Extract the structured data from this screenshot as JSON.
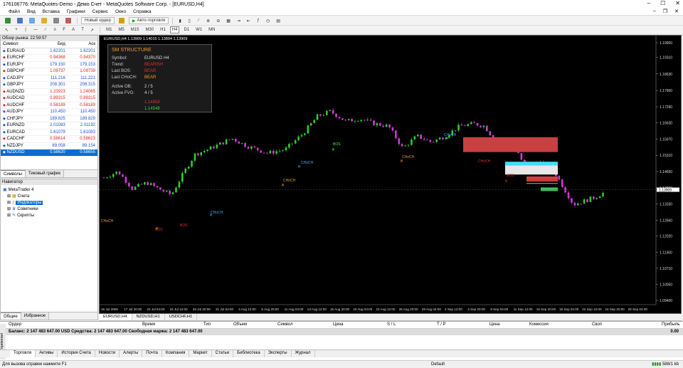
{
  "window": {
    "title": "176106776: MetaQuotes-Demo - Демо Счет - MetaQuotes Software Corp. - [EURUSD,H4]"
  },
  "menu": [
    "Файл",
    "Вид",
    "Вставка",
    "Графики",
    "Сервис",
    "Окно",
    "Справка"
  ],
  "toolbar": {
    "new_order": "Новый ордер",
    "autotrading": "Авто-торговля",
    "timeframes": [
      "M1",
      "M5",
      "M15",
      "M30",
      "H1",
      "H4",
      "D1",
      "W1",
      "MN"
    ]
  },
  "market_watch": {
    "header": "Обзор рынка: 22:59:57",
    "columns": [
      "Символ",
      "Бид",
      "Аск"
    ],
    "rows": [
      {
        "symbol": "EURAUD",
        "bid": "1.62201",
        "ask": "1.62201",
        "color": "#1a4fd6"
      },
      {
        "symbol": "EURCHF",
        "bid": "0.94368",
        "ask": "0.94370",
        "color": "#e02020"
      },
      {
        "symbol": "EURJPY",
        "bid": "179.150",
        "ask": "179.153",
        "color": "#1a4fd6"
      },
      {
        "symbol": "GBPCHF",
        "bid": "1.09737",
        "ask": "1.09739",
        "color": "#e02020"
      },
      {
        "symbol": "CADJPY",
        "bid": "111.216",
        "ask": "111.221",
        "color": "#1a4fd6"
      },
      {
        "symbol": "GBPJPY",
        "bid": "208.301",
        "ask": "208.315",
        "color": "#1a4fd6"
      },
      {
        "symbol": "AUDNZD",
        "bid": "1.23923",
        "ask": "1.24065",
        "color": "#e02020"
      },
      {
        "symbol": "AUDCAD",
        "bid": "0.89315",
        "ask": "0.89315",
        "color": "#e02020"
      },
      {
        "symbol": "AUDCHF",
        "bid": "0.58189",
        "ask": "0.58189",
        "color": "#e02020"
      },
      {
        "symbol": "AUDJPY",
        "bid": "110.450",
        "ask": "110.450",
        "color": "#1a4fd6"
      },
      {
        "symbol": "CHFJPY",
        "bid": "189.825",
        "ask": "189.829",
        "color": "#1a4fd6"
      },
      {
        "symbol": "EURNZD",
        "bid": "2.01083",
        "ask": "2.01192",
        "color": "#1a4fd6"
      },
      {
        "symbol": "EURCAD",
        "bid": "1.61079",
        "ask": "1.61083",
        "color": "#1a4fd6"
      },
      {
        "symbol": "CADCHF",
        "bid": "0.58614",
        "ask": "0.58623",
        "color": "#e02020"
      },
      {
        "symbol": "NZDJPY",
        "bid": "89.058",
        "ask": "89.154",
        "color": "#1a4fd6"
      },
      {
        "symbol": "NZDUSD",
        "bid": "0.58620",
        "ask": "0.58655",
        "color": "#ffffff"
      }
    ],
    "tabs": [
      "Символы",
      "Тиковый график"
    ]
  },
  "navigator": {
    "header": "Навигатор",
    "items": [
      "MetaTrader 4",
      "Счета",
      "Индикаторы",
      "Советники",
      "Скрипты"
    ],
    "tabs": [
      "Общие",
      "Избранное"
    ]
  },
  "chart": {
    "title": "EURUSD,H4  1.13909 1.14015 1.13894 1.13909",
    "tabs": [
      "EURUSD,H4",
      "NZDUSD,H1",
      "USDCHF,H1"
    ],
    "price_labels": [
      "1.19900",
      "1.19310",
      "1.18630",
      "1.17950",
      "1.17290",
      "1.16630",
      "1.15970",
      "1.15310",
      "1.14650",
      "1.13990",
      "1.13330",
      "1.12660",
      "1.12020",
      "1.11360",
      "1.10710",
      "1.10050",
      "1.09400"
    ],
    "current_price": "1.13909",
    "time_labels": [
      "15 Jul 2008",
      "17 Jul 20:00",
      "22 Jul 04:00",
      "24 Jul 12:00",
      "28 Jul 20:00",
      "31 Jul 04:00",
      "4 Aug 12:00",
      "6 Aug 20:00",
      "11 Aug 04:00",
      "13 Aug 12:00",
      "15 Aug 20:00",
      "20 Aug 04:00",
      "22 Aug 12:00",
      "26 Aug 20:00",
      "29 Aug 04:00",
      "2 Sep 12:00",
      "4 Sep 20:00",
      "9 Sep 04:00",
      "11 Sep 12:00",
      "15 Sep 20:00",
      "18 Sep 04:00",
      "22 Sep 12:00",
      "24 Sep 20:00",
      "29 Sep 04:00"
    ],
    "annotations": {
      "bos": "BOS",
      "choch": "CHoCH"
    }
  },
  "sm_panel": {
    "title": "SM STRUCTURE",
    "rows": [
      {
        "k": "Symbol:",
        "v": "EURUSD H4",
        "c": "#dddddd"
      },
      {
        "k": "Trend:",
        "v": "BEARISH",
        "c": "#e03030"
      },
      {
        "k": "Last BOS:",
        "v": "BEAR",
        "c": "#e03030"
      },
      {
        "k": "Last CHoCH:",
        "v": "BEAR",
        "c": "#f0a020"
      },
      {
        "k": "Active OB:",
        "v": "2 / 5",
        "c": "#dddddd"
      },
      {
        "k": "Active FVG:",
        "v": "4 / 5",
        "c": "#dddddd"
      }
    ],
    "levels": [
      {
        "v": "1.14958",
        "c": "#e03030"
      },
      {
        "v": "1.14548",
        "c": "#40d040"
      }
    ]
  },
  "terminal": {
    "columns": [
      "Ордер",
      "Время",
      "Тип",
      "Объем",
      "Символ",
      "Цена",
      "S / L",
      "T / P",
      "Цена",
      "Комиссия",
      "Своп",
      "Прибыль"
    ],
    "balance": "Баланс: 2 147 483 647.00 USD  Средства: 2 147 483 647.00  Свободная маржа: 2 147 483 647.00",
    "profit": "0.00",
    "tabs": [
      "Торговля",
      "Активы",
      "История Счета",
      "Новости",
      "Алерты",
      "Почта",
      "Компания",
      "Маркет",
      "Статьи",
      "Библиотека",
      "Эксперты",
      "Журнал"
    ],
    "side_label": "Терминал"
  },
  "status": {
    "help": "Для вызова справки нажмите F1",
    "profile": "Default",
    "traffic": "588/1 kb"
  }
}
